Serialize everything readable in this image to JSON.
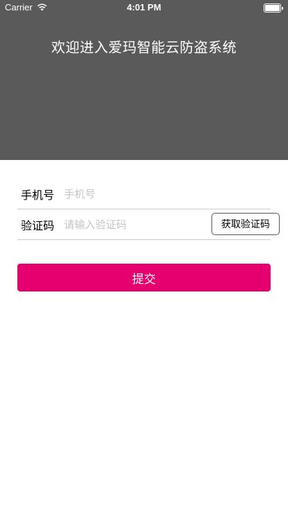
{
  "status_bar": {
    "carrier": "Carrier",
    "time": "4:01 PM",
    "icons": [
      "wifi-icon",
      "battery-icon"
    ]
  },
  "header": {
    "title": "欢迎进入爱玛智能云防盗系统",
    "background_color": "#5b5a5a"
  },
  "form": {
    "phone": {
      "label": "手机号",
      "placeholder": "手机号",
      "value": ""
    },
    "code": {
      "label": "验证码",
      "placeholder": "请输入验证码",
      "value": "",
      "button_label": "获取验证码"
    },
    "submit_label": "提交",
    "submit_color": "#e6006f"
  }
}
